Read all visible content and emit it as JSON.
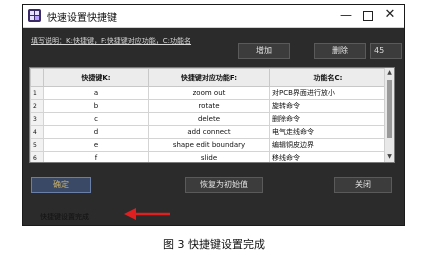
{
  "window": {
    "title": "快速设置快捷键",
    "controls": {
      "minimize": "—",
      "close": "✕"
    }
  },
  "toolbar": {
    "instruction": "填写说明：K:快捷键，F:快捷键对应功能，C:功能名",
    "add_label": "增加",
    "delete_label": "删除",
    "count_value": "45"
  },
  "table": {
    "columns": [
      "快捷键K:",
      "快捷键对应功能F:",
      "功能名C:"
    ],
    "rows": [
      {
        "num": "1",
        "key": "a",
        "func": "zoom out",
        "name": "对PCB界面进行放小"
      },
      {
        "num": "2",
        "key": "b",
        "func": "rotate",
        "name": "旋转命令"
      },
      {
        "num": "3",
        "key": "c",
        "func": "delete",
        "name": "删除命令"
      },
      {
        "num": "4",
        "key": "d",
        "func": "add connect",
        "name": "电气走线命令"
      },
      {
        "num": "5",
        "key": "e",
        "func": "shape edit boundary",
        "name": "编辑铜皮边界"
      },
      {
        "num": "6",
        "key": "f",
        "func": "slide",
        "name": "移线命令"
      }
    ]
  },
  "footer": {
    "ok_label": "确定",
    "reset_label": "恢复为初始值",
    "close_label": "关闭"
  },
  "status": {
    "text": "快捷键设置完成"
  },
  "caption": "图 3  快捷键设置完成",
  "colors": {
    "window_bg": "#2b2b2b",
    "arrow": "#e02020"
  }
}
